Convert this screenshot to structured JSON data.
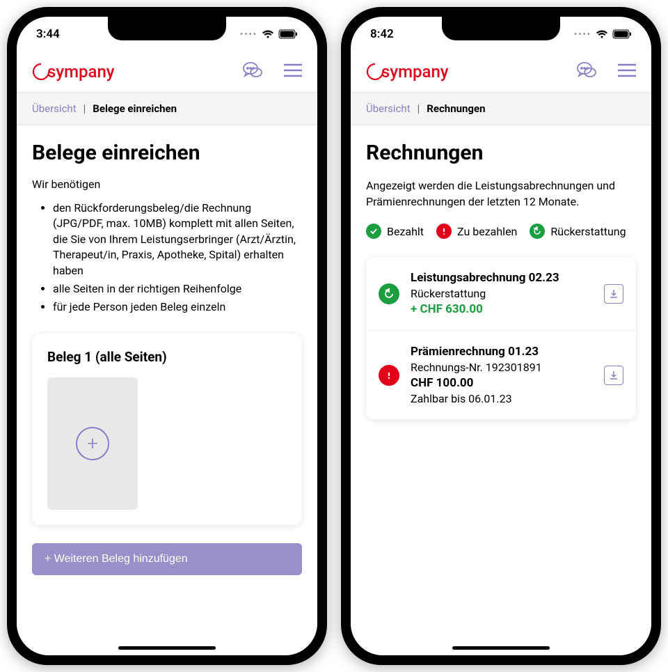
{
  "brand": "sympany",
  "phones": {
    "left": {
      "time": "3:44",
      "breadcrumb": {
        "root": "Übersicht",
        "current": "Belege einreichen"
      },
      "title": "Belege einreichen",
      "intro": "Wir benötigen",
      "requirements": [
        "den Rückforderungsbeleg/die Rechnung (JPG/PDF, max. 10MB) komplett mit allen Seiten, die Sie von Ihrem Leistungserbringer (Arzt/Ärztin, Therapeut/in, Praxis, Apotheke, Spital) erhalten haben",
        "alle Seiten in der richtigen Reihenfolge",
        "für jede Person jeden Beleg einzeln"
      ],
      "card_title": "Beleg 1 (alle Seiten)",
      "add_button": "+ Weiteren Beleg hinzufügen"
    },
    "right": {
      "time": "8:42",
      "breadcrumb": {
        "root": "Übersicht",
        "current": "Rechnungen"
      },
      "title": "Rechnungen",
      "description": "Angezeigt werden die Leistungsabrechnungen und Prämienrechnungen der letzten 12 Monate.",
      "legend": {
        "paid": "Bezahlt",
        "due": "Zu bezahlen",
        "refund": "Rückerstattung"
      },
      "invoices": [
        {
          "title": "Leistungsabrechnung 02.23",
          "sub": "Rückerstattung",
          "amount": "+ CHF 630.00",
          "type": "refund"
        },
        {
          "title": "Prämienrechnung 01.23",
          "sub": "Rechnungs-Nr. 192301891",
          "amount": "CHF 100.00",
          "due": "Zahlbar bis 06.01.23",
          "type": "due"
        }
      ]
    }
  }
}
